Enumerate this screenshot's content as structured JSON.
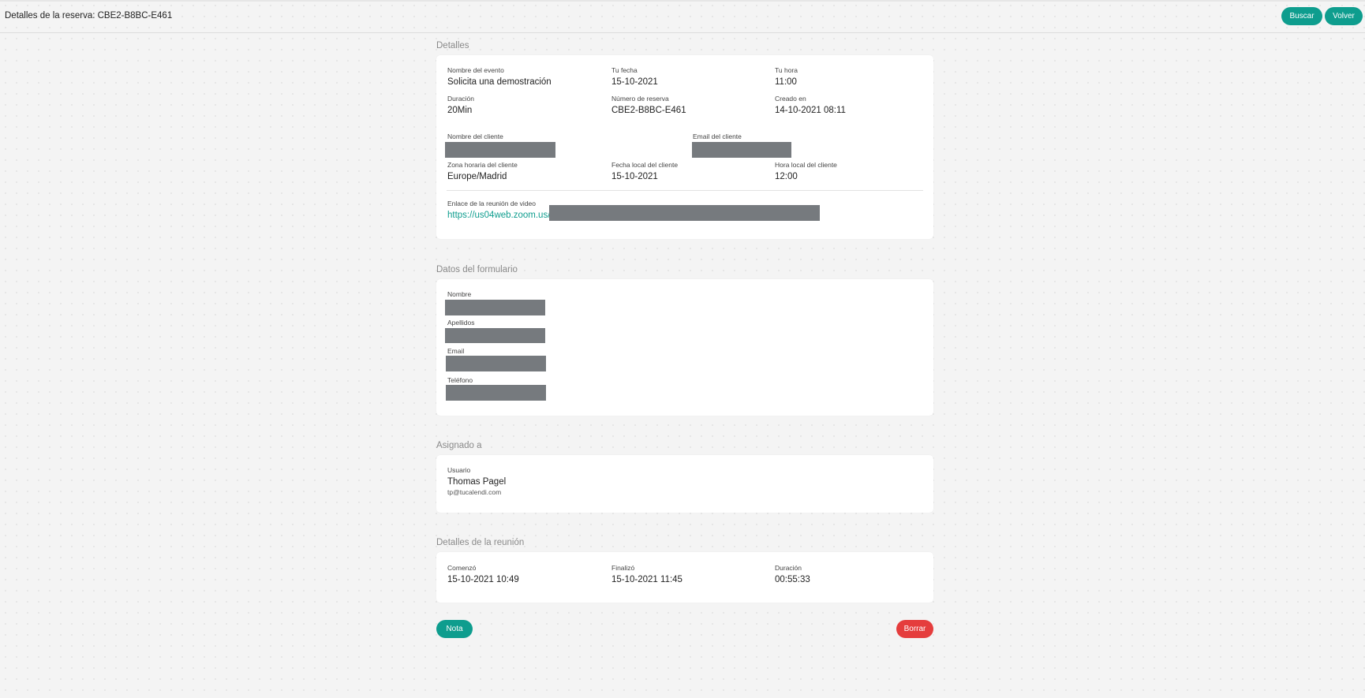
{
  "header": {
    "title": "Detalles de la reserva: CBE2-B8BC-E461",
    "search_label": "Buscar",
    "back_label": "Volver"
  },
  "details": {
    "section_title": "Detalles",
    "event_name_label": "Nombre del evento",
    "event_name": "Solicita una demostración",
    "date_label": "Tu fecha",
    "date": "15-10-2021",
    "time_label": "Tu hora",
    "time": "11:00",
    "duration_label": "Duración",
    "duration": "20Min",
    "booking_number_label": "Número de reserva",
    "booking_number": "CBE2-B8BC-E461",
    "created_label": "Creado en",
    "created": "14-10-2021 08:11",
    "client_name_label": "Nombre del cliente",
    "client_email_label": "Email del cliente",
    "client_tz_label": "Zona horaria del cliente",
    "client_tz": "Europe/Madrid",
    "client_local_date_label": "Fecha local del cliente",
    "client_local_date": "15-10-2021",
    "client_local_time_label": "Hora local del cliente",
    "client_local_time": "12:00",
    "video_link_label": "Enlace de la reunión de video",
    "video_link": "https://us04web.zoom.us/"
  },
  "form": {
    "section_title": "Datos del formulario",
    "first_name_label": "Nombre",
    "last_name_label": "Apellidos",
    "email_label": "Email",
    "phone_label": "Teléfono"
  },
  "assigned": {
    "section_title": "Asignado a",
    "user_label": "Usuario",
    "user_name": "Thomas Pagel",
    "user_email": "tp@tucalendi.com"
  },
  "meeting": {
    "section_title": "Detalles de la reunión",
    "started_label": "Comenzó",
    "started": "15-10-2021 10:49",
    "ended_label": "Finalizó",
    "ended": "15-10-2021 11:45",
    "duration_label": "Duración",
    "duration": "00:55:33"
  },
  "actions": {
    "note_label": "Nota",
    "delete_label": "Borrar"
  },
  "colors": {
    "accent": "#0e9d8e",
    "danger": "#e53d3d",
    "redaction": "#767a7e"
  }
}
